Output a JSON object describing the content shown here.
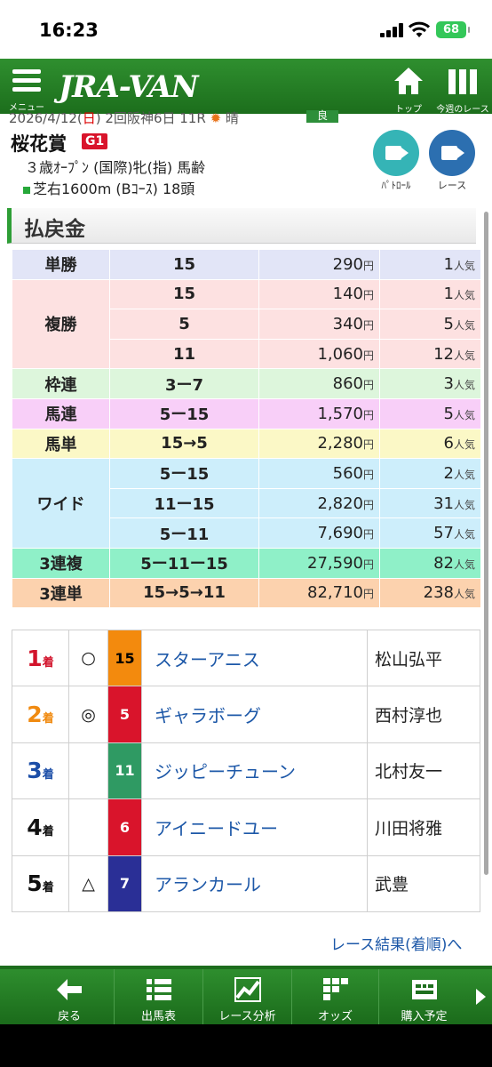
{
  "status": {
    "time": "16:23",
    "battery": "68"
  },
  "header": {
    "logo": "JRA-VAN",
    "menu_label": "メニュー",
    "top_label": "トップ",
    "week_label": "今週のレース"
  },
  "race": {
    "date_pre": "2026/4/12(",
    "date_day": "日",
    "date_post": ") 2回阪神6日 11R",
    "weather": "晴",
    "going": "良",
    "title": "桜花賞",
    "grade": "G1",
    "condition": "３歳ｵｰﾌﾟﾝ (国際)牝(指) 馬齢",
    "distance": "芝右1600m (Bｺｰｽ) 18頭",
    "patrol_label": "ﾊﾟﾄﾛｰﾙ",
    "race_video_label": "レース",
    "colors": {
      "patrol": "#35b4b6",
      "race_video": "#2c6fb0"
    }
  },
  "payout": {
    "title": "払戻金",
    "yen": "円",
    "ninki": "人気",
    "rows": [
      {
        "bet": "単勝",
        "combo": "15",
        "amount": "290",
        "pop": "1",
        "color": "#e2e5f7"
      },
      {
        "bet": "複勝",
        "combo": "15",
        "amount": "140",
        "pop": "1",
        "color": "#fde1e1"
      },
      {
        "bet": "",
        "combo": "5",
        "amount": "340",
        "pop": "5",
        "color": "#fde1e1"
      },
      {
        "bet": "",
        "combo": "11",
        "amount": "1,060",
        "pop": "12",
        "color": "#fde1e1"
      },
      {
        "bet": "枠連",
        "combo": "3ー7",
        "amount": "860",
        "pop": "3",
        "color": "#ddf6dc"
      },
      {
        "bet": "馬連",
        "combo": "5ー15",
        "amount": "1,570",
        "pop": "5",
        "color": "#f8cff8"
      },
      {
        "bet": "馬単",
        "combo": "15→5",
        "amount": "2,280",
        "pop": "6",
        "color": "#fbf8c6"
      },
      {
        "bet": "ワイド",
        "combo": "5ー15",
        "amount": "560",
        "pop": "2",
        "color": "#cdeefb"
      },
      {
        "bet": "",
        "combo": "11ー15",
        "amount": "2,820",
        "pop": "31",
        "color": "#cdeefb"
      },
      {
        "bet": "",
        "combo": "5ー11",
        "amount": "7,690",
        "pop": "57",
        "color": "#cdeefb"
      },
      {
        "bet": "3連複",
        "combo": "5ー11ー15",
        "amount": "27,590",
        "pop": "82",
        "color": "#8ff0c8"
      },
      {
        "bet": "3連単",
        "combo": "15→5→11",
        "amount": "82,710",
        "pop": "238",
        "color": "#fcd2ae"
      }
    ]
  },
  "results": {
    "suffix": "着",
    "rows": [
      {
        "rank": "1",
        "rank_color": "#d2142c",
        "mark": "○",
        "num": "15",
        "num_bg": "#f38a0d",
        "num_fg": "#000000",
        "horse": "スターアニス",
        "jockey": "松山弘平"
      },
      {
        "rank": "2",
        "rank_color": "#f08a10",
        "mark": "◎",
        "num": "5",
        "num_bg": "#d9142b",
        "num_fg": "#ffffff",
        "horse": "ギャラボーグ",
        "jockey": "西村淳也"
      },
      {
        "rank": "3",
        "rank_color": "#1d4fa8",
        "mark": "",
        "num": "11",
        "num_bg": "#2f9a63",
        "num_fg": "#ffffff",
        "horse": "ジッピーチューン",
        "jockey": "北村友一"
      },
      {
        "rank": "4",
        "rank_color": "#111111",
        "mark": "",
        "num": "6",
        "num_bg": "#d9142b",
        "num_fg": "#ffffff",
        "horse": "アイニードユー",
        "jockey": "川田将雅"
      },
      {
        "rank": "5",
        "rank_color": "#111111",
        "mark": "△",
        "num": "7",
        "num_bg": "#2a2f96",
        "num_fg": "#ffffff",
        "horse": "アランカール",
        "jockey": "武豊"
      }
    ],
    "link": "レース結果(着順)へ"
  },
  "bottom_nav": {
    "items": [
      {
        "label": "戻る",
        "icon": "back-arrow-icon"
      },
      {
        "label": "出馬表",
        "icon": "list-icon"
      },
      {
        "label": "レース分析",
        "icon": "analysis-chart-icon"
      },
      {
        "label": "オッズ",
        "icon": "odds-icon"
      },
      {
        "label": "購入予定",
        "icon": "purchase-plan-icon"
      }
    ]
  }
}
